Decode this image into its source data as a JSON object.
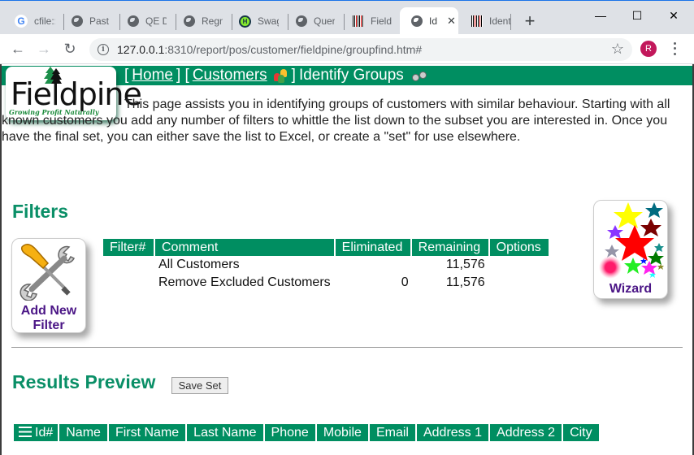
{
  "browser": {
    "tabs": [
      {
        "label": "cfile::",
        "favicon": "google-icon",
        "active": false
      },
      {
        "label": "Past S",
        "favicon": "globe-icon",
        "active": false
      },
      {
        "label": "QE De",
        "favicon": "globe-icon",
        "active": false
      },
      {
        "label": "Regne",
        "favicon": "globe-icon",
        "active": false
      },
      {
        "label": "Swagg",
        "favicon": "swagger-icon",
        "active": false
      },
      {
        "label": "Query",
        "favicon": "globe-icon",
        "active": false
      },
      {
        "label": "Fieldp",
        "favicon": "barcode-icon",
        "active": false
      },
      {
        "label": "Id",
        "favicon": "globe-icon",
        "active": true
      },
      {
        "label": "Ident",
        "favicon": "barcode-icon",
        "active": false
      }
    ],
    "new_tab_symbol": "+",
    "window_controls": {
      "minimize": "—",
      "maximize": "☐",
      "close": "✕"
    },
    "url_host": "127.0.0.1",
    "url_rest": ":8310/report/pos/customer/fieldpine/groupfind.htm#",
    "profile_initial": "R",
    "accent_color": "#1a73e8",
    "profile_color": "#c2185b"
  },
  "header": {
    "logo": {
      "name": "Fieldpine",
      "tagline": "Growing Profit Naturally"
    },
    "breadcrumb": {
      "open1": "[",
      "home": "Home",
      "close1": "] [",
      "customers": "Customers",
      "close2": "]",
      "current": "Identify Groups"
    },
    "brand_color": "#008e61"
  },
  "intro": "This page assists you in identifying groups of customers with similar behaviour. Starting with all known customers you add any number of filters to whittle the list down to the subset you are interested in. Once you have the final set, you can either save the list to Excel, or create a \"set\" for use elsewhere.",
  "filters": {
    "title": "Filters",
    "add_button": {
      "line1": "Add New",
      "line2": "Filter"
    },
    "wizard_button": "Wizard",
    "columns": [
      "Filter#",
      "Comment",
      "Eliminated",
      "Remaining",
      "Options"
    ],
    "rows": [
      {
        "filter_no": "",
        "comment": "All Customers",
        "eliminated": "",
        "remaining": "11,576",
        "options": ""
      },
      {
        "filter_no": "",
        "comment": "Remove Excluded Customers",
        "eliminated": "0",
        "remaining": "11,576",
        "options": ""
      }
    ]
  },
  "results": {
    "title": "Results Preview",
    "save_set_label": "Save Set",
    "columns": [
      "Id#",
      "Name",
      "First Name",
      "Last Name",
      "Phone",
      "Mobile",
      "Email",
      "Address 1",
      "Address 2",
      "City"
    ]
  }
}
